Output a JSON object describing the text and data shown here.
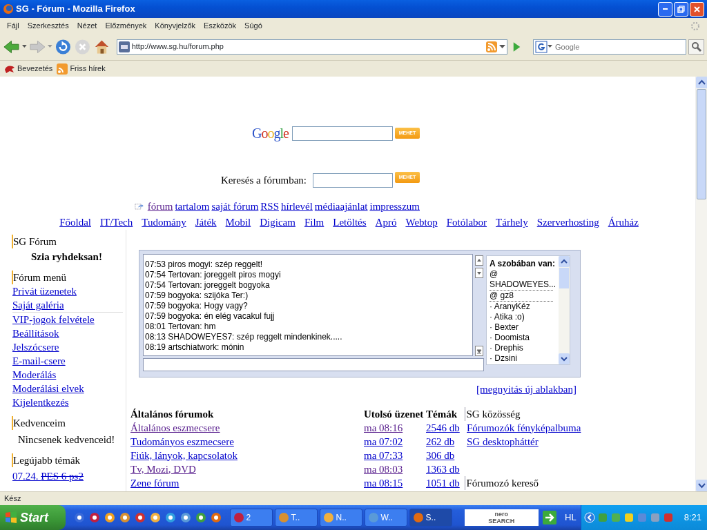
{
  "window": {
    "title": "SG - Fórum - Mozilla Firefox"
  },
  "menu": [
    "Fájl",
    "Szerkesztés",
    "Nézet",
    "Előzmények",
    "Könyvjelzők",
    "Eszközök",
    "Súgó"
  ],
  "toolbar": {
    "url": "http://www.sg.hu/forum.php",
    "search_placeholder": "Google"
  },
  "bookmarks": [
    "Bevezetés",
    "Friss hírek"
  ],
  "page": {
    "google_search": {
      "logo": "Google",
      "button": "MEHET"
    },
    "forum_search": {
      "label": "Keresés a fórumban:",
      "button": "MEHET"
    },
    "top_links": [
      "fórum",
      "tartalom",
      "saját fórum",
      "RSS",
      "hírlevél",
      "médiaajánlat",
      "impresszum"
    ],
    "nav_links": [
      "Főoldal",
      "IT/Tech",
      "Tudomány",
      "Játék",
      "Mobil",
      "Digicam",
      "Film",
      "Letöltés",
      "Apró",
      "Webtop",
      "Fotólabor",
      "Tárhely",
      "Szerverhosting",
      "Áruház"
    ],
    "sidebar": {
      "title": "SG Fórum",
      "greeting": "Szia ryhdeksan!",
      "menu_title": "Fórum menü",
      "menu_items": [
        "Privát üzenetek",
        "Saját galéria",
        "VIP-jogok felvétele",
        "Beállítások",
        "Jelszócsere",
        "E-mail-csere",
        "Moderálás",
        "Moderálási elvek",
        "Kijelentkezés"
      ],
      "favorites_title": "Kedvenceim",
      "favorites_empty": "Nincsenek kedvenceid!",
      "latest_title": "Legújabb témák",
      "latest": [
        {
          "date": "07.24.",
          "title": "PES 6 ps2",
          "struck": true
        }
      ]
    },
    "chat": {
      "messages": [
        "07:53 piros mogyi: szép reggelt!",
        "07:54 Tertovan: joreggelt piros mogyi",
        "07:54 Tertovan: joreggelt bogyoka",
        "07:59 bogyoka: szijóka Ter:)",
        "07:59 bogyoka: Hogy vagy?",
        "07:59 bogyoka: én elég vacakul fujj",
        "08:01 Tertovan: hm",
        "08:13 SHADOWEYES7: szép reggelt mindenkinek.....",
        "08:19 artschiatwork: mónin"
      ],
      "users_title": "A szobában van:",
      "users": [
        {
          "name": "@ SHADOWEYES...",
          "kind": "moderator"
        },
        {
          "name": "@ gz8",
          "kind": "moderator"
        },
        {
          "name": "· AranyKéz",
          "kind": "user"
        },
        {
          "name": "· Atika :o)",
          "kind": "user"
        },
        {
          "name": "· Bexter",
          "kind": "user"
        },
        {
          "name": "· Doomista",
          "kind": "user"
        },
        {
          "name": "· Drephis",
          "kind": "user"
        },
        {
          "name": "· Dzsini",
          "kind": "user"
        }
      ]
    },
    "open_link": "[megnyitás új ablakban]",
    "forums": {
      "columns": [
        "Általános fórumok",
        "Utolsó üzenet",
        "Témák"
      ],
      "rows": [
        {
          "name": "Általános eszmecsere",
          "last": "ma 08:16",
          "topics": "2546 db",
          "visited": true
        },
        {
          "name": "Tudományos eszmecsere",
          "last": "ma 07:02",
          "topics": "262 db",
          "visited": false
        },
        {
          "name": "Fiúk, lányok, kapcsolatok",
          "last": "ma 07:33",
          "topics": "306 db",
          "visited": false
        },
        {
          "name": "Tv, Mozi, DVD",
          "last": "ma 08:03",
          "topics": "1363 db",
          "visited": true
        },
        {
          "name": "Zene fórum",
          "last": "ma 08:15",
          "topics": "1051 db",
          "visited": false
        }
      ]
    },
    "community": {
      "title": "SG közösség",
      "links": [
        "Fórumozók fényképalbuma",
        "SG desktopháttér"
      ],
      "search_title": "Fórumozó kereső"
    }
  },
  "status_bar": "Kész",
  "taskbar": {
    "start": "Start",
    "tasks": [
      {
        "label": "2",
        "selected": false
      },
      {
        "label": "T..",
        "selected": false
      },
      {
        "label": "N..",
        "selected": false
      },
      {
        "label": "W..",
        "selected": false
      },
      {
        "label": "S..",
        "selected": true
      }
    ],
    "nero": {
      "line_1": "nero",
      "line_2": "SEARCH"
    },
    "language": "HL",
    "clock": "8:21"
  }
}
